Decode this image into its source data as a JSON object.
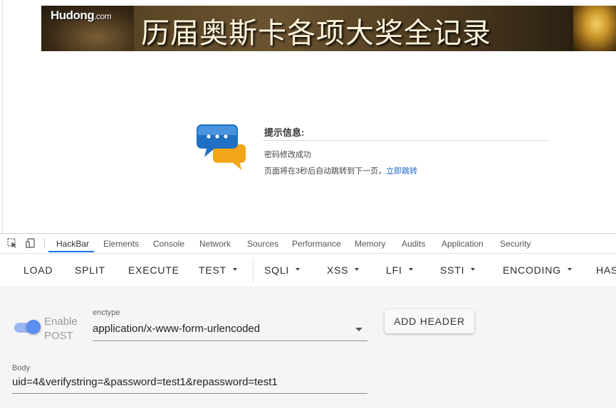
{
  "banner": {
    "logo": "Hudong",
    "logo_suffix": ".com",
    "title": "历届奥斯卡各项大奖全记录"
  },
  "message": {
    "title": "提示信息:",
    "line1": "密码修改成功",
    "line2": "页面将在3秒后自动跳转到下一页，",
    "link": "立即跳转"
  },
  "devtools": {
    "tabs": [
      "HackBar",
      "Elements",
      "Console",
      "Network",
      "Sources",
      "Performance",
      "Memory",
      "Audits",
      "Application",
      "Security"
    ],
    "active_tab": "HackBar"
  },
  "hackbar": {
    "toolbar": {
      "load": "LOAD",
      "split": "SPLIT",
      "execute": "EXECUTE",
      "test": "TEST",
      "sqli": "SQLI",
      "xss": "XSS",
      "lfi": "LFI",
      "ssti": "SSTI",
      "encoding": "ENCODING",
      "hash": "HAS"
    },
    "enable_post": {
      "label_line1": "Enable",
      "label_line2": "POST",
      "checked": true
    },
    "enctype": {
      "label": "enctype",
      "value": "application/x-www-form-urlencoded"
    },
    "add_header_label": "ADD HEADER",
    "body": {
      "label": "Body",
      "value": "uid=4&verifystring=&password=test1&repassword=test1"
    }
  },
  "colors": {
    "accent": "#1a73e8",
    "toggle": "#5b8ef2",
    "link": "#1a66c9"
  }
}
